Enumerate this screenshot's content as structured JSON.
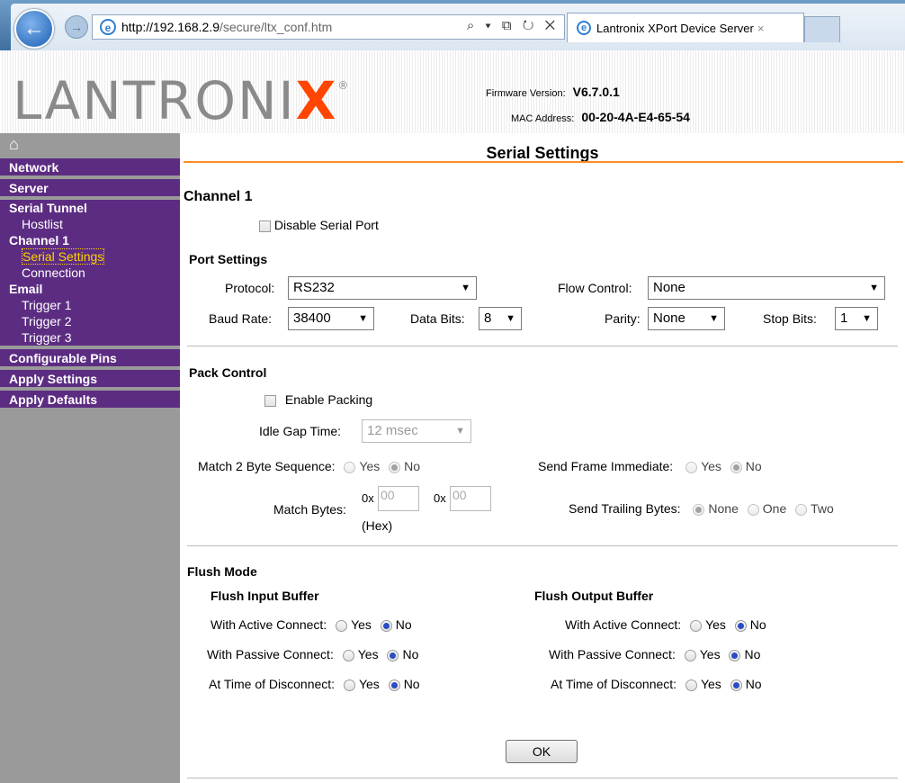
{
  "browser": {
    "url_host": "http://192.168.2.9",
    "url_path": "/secure/ltx_conf.htm",
    "address_tools": "⌕ ▾ ⧉ ↻ ✕",
    "tab_title": "Lantronix XPort Device Server",
    "tab_close": "×"
  },
  "header": {
    "logo_main": "LANTRONI",
    "logo_x": "X",
    "logo_reg": "®",
    "firmware_label": "Firmware Version:",
    "firmware_value": "V6.7.0.1",
    "mac_label": "MAC Address:",
    "mac_value": "00-20-4A-E4-65-54"
  },
  "sidebar": {
    "home_icon": "⌂",
    "network": "Network",
    "server": "Server",
    "serial_tunnel": "Serial Tunnel",
    "hostlist": "Hostlist",
    "channel1": "Channel 1",
    "serial_settings": "Serial Settings",
    "connection": "Connection",
    "email": "Email",
    "trigger1": "Trigger 1",
    "trigger2": "Trigger 2",
    "trigger3": "Trigger 3",
    "configurable_pins": "Configurable Pins",
    "apply_settings": "Apply Settings",
    "apply_defaults": "Apply Defaults"
  },
  "main": {
    "title": "Serial Settings",
    "channel": "Channel 1",
    "disable_serial_port": "Disable Serial Port",
    "port_settings": {
      "heading": "Port Settings",
      "protocol_label": "Protocol:",
      "protocol_value": "RS232",
      "flow_control_label": "Flow Control:",
      "flow_control_value": "None",
      "baud_rate_label": "Baud Rate:",
      "baud_rate_value": "38400",
      "data_bits_label": "Data Bits:",
      "data_bits_value": "8",
      "parity_label": "Parity:",
      "parity_value": "None",
      "stop_bits_label": "Stop Bits:",
      "stop_bits_value": "1"
    },
    "pack_control": {
      "heading": "Pack Control",
      "enable_packing": "Enable Packing",
      "idle_gap_label": "Idle Gap Time:",
      "idle_gap_value": "12 msec",
      "match2_label": "Match 2 Byte Sequence:",
      "yes": "Yes",
      "no": "No",
      "send_frame_label": "Send Frame Immediate:",
      "match_bytes_label": "Match Bytes:",
      "hex_prefix": "0x",
      "match_byte1": "00",
      "match_byte2": "00",
      "hex_note": "(Hex)",
      "send_trailing_label": "Send Trailing Bytes:",
      "trailing_none": "None",
      "trailing_one": "One",
      "trailing_two": "Two"
    },
    "flush_mode": {
      "heading": "Flush Mode",
      "input_heading": "Flush Input Buffer",
      "output_heading": "Flush Output Buffer",
      "active": "With Active Connect:",
      "passive": "With Passive Connect:",
      "disconnect": "At Time of Disconnect:",
      "yes": "Yes",
      "no": "No"
    },
    "ok_button": "OK"
  }
}
